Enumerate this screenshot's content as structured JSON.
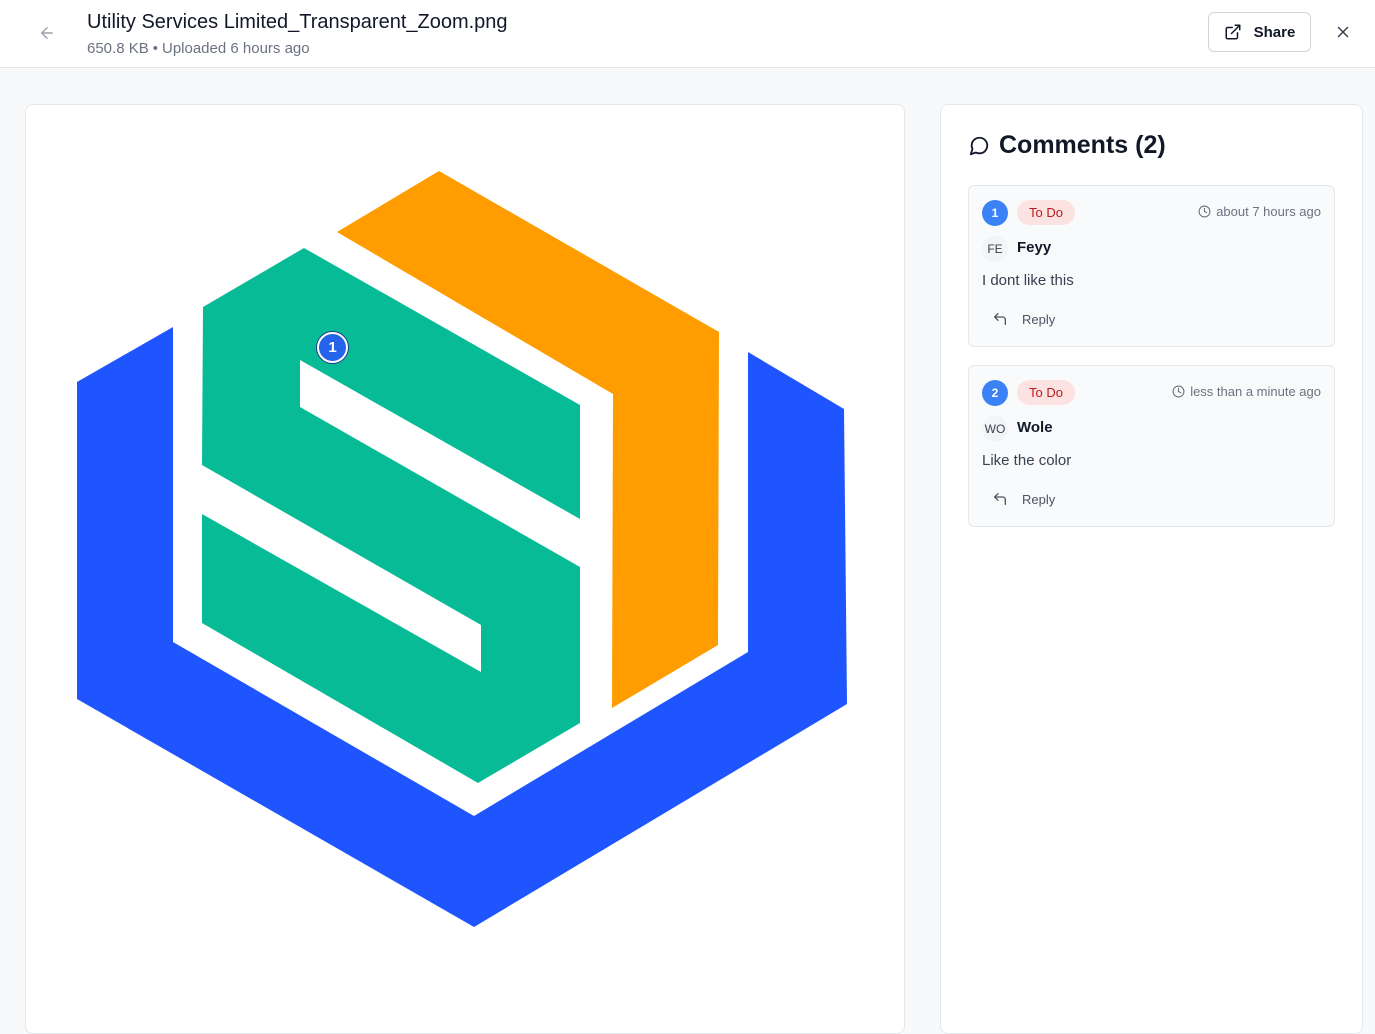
{
  "header": {
    "title": "Utility Services Limited_Transparent_Zoom.png",
    "size": "650.8 KB",
    "separator": "•",
    "uploaded": "Uploaded 6 hours ago",
    "share_label": "Share",
    "back_icon": "arrow-left-icon",
    "share_icon": "external-link-icon",
    "close_icon": "close-icon"
  },
  "viewer": {
    "pins": [
      {
        "number": "1"
      }
    ],
    "logo_colors": {
      "blue": "#1f55ff",
      "green": "#07bb97",
      "orange": "#ff9d00"
    }
  },
  "comments": {
    "title": "Comments (2)",
    "icon": "message-circle-icon",
    "items": [
      {
        "number": "1",
        "status": "To Do",
        "time": "about 7 hours ago",
        "initials": "FE",
        "author": "Feyy",
        "text": "I dont like this",
        "reply_label": "Reply"
      },
      {
        "number": "2",
        "status": "To Do",
        "time": "less than a minute ago",
        "initials": "WO",
        "author": "Wole",
        "text": "Like the color",
        "reply_label": "Reply"
      }
    ]
  },
  "colors": {
    "accent": "#3b82f6",
    "status_bg": "#fde2e2",
    "status_text": "#b91c1c"
  }
}
